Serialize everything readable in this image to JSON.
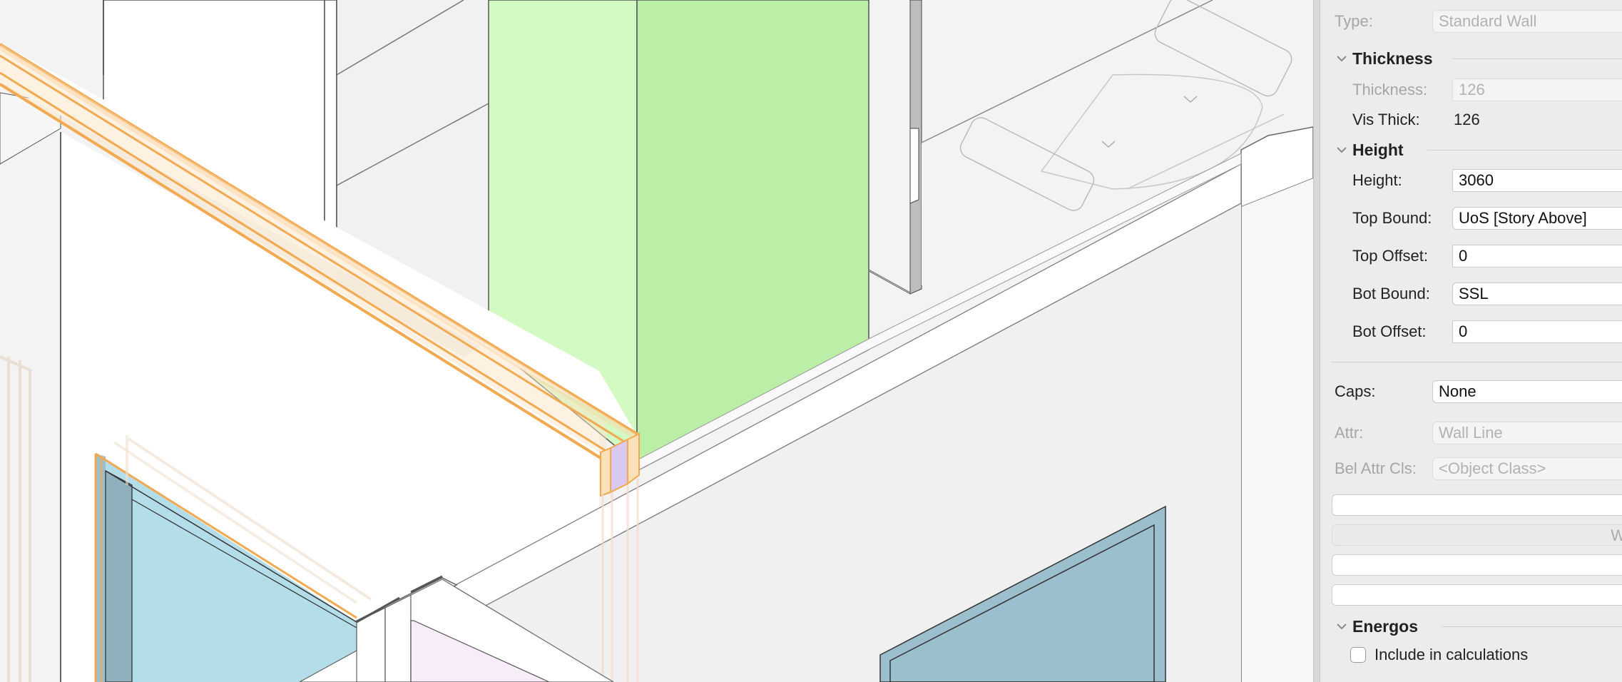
{
  "colors": {
    "viewport_bg": "#f3f3f3",
    "wall_white": "#ffffff",
    "green_light": "#d4fac4",
    "green_dark": "#bbeea6",
    "glass_blue": "#b3dde9",
    "glass_blue_dark": "#9bbfcc",
    "selection_orange": "#f2a950",
    "lavender": "#d9c8f0",
    "pink": "#f9ecfa",
    "palette_bg": "#ececec"
  },
  "palette": {
    "type": {
      "label": "Type:",
      "value": "Standard Wall"
    },
    "thickness_section": {
      "title": "Thickness",
      "thickness": {
        "label": "Thickness:",
        "value": "126"
      },
      "vis_thick": {
        "label": "Vis Thick:",
        "value": "126"
      }
    },
    "height_section": {
      "title": "Height",
      "height": {
        "label": "Height:",
        "value": "3060"
      },
      "top_bound": {
        "label": "Top Bound:",
        "value": "UoS [Story Above]"
      },
      "top_offset": {
        "label": "Top Offset:",
        "value": "0"
      },
      "bot_bound": {
        "label": "Bot Bound:",
        "value": "SSL"
      },
      "bot_offset": {
        "label": "Bot Offset:",
        "value": "0"
      }
    },
    "caps": {
      "label": "Caps:",
      "value": "None"
    },
    "attr": {
      "label": "Attr:",
      "value": "Wall Line"
    },
    "bel_attr_cls": {
      "label": "Bel Attr Cls:",
      "value": "<Object Class>"
    },
    "truncated_button": {
      "label": "W"
    },
    "energos_section": {
      "title": "Energos",
      "include": {
        "label": "Include in calculations",
        "checked": false
      }
    }
  }
}
